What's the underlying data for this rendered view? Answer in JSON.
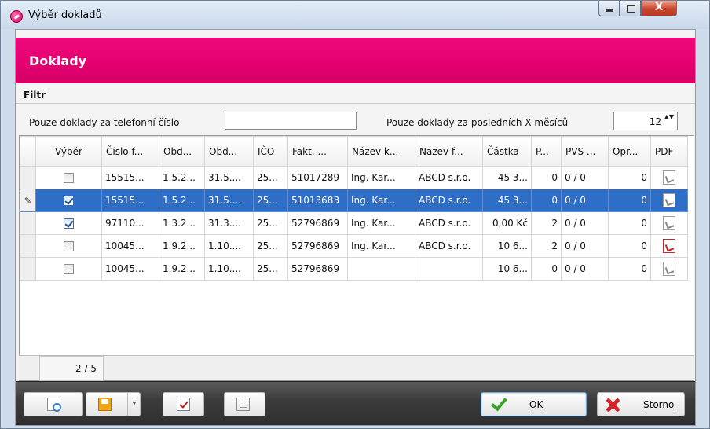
{
  "window": {
    "title": "Výběr dokladů",
    "close_glyph": "X"
  },
  "header": {
    "title": "Doklady"
  },
  "filter": {
    "section_label": "Filtr",
    "phone_label": "Pouze doklady za telefonní číslo",
    "phone_value": "",
    "months_label": "Pouze doklady za posledních X měsíců",
    "months_value": "12",
    "spin_arrows": "▲▼"
  },
  "grid": {
    "columns": [
      "Výběr",
      "Číslo f...",
      "Obd...",
      "Obd...",
      "IČO",
      "Fakt. ...",
      "Název k...",
      "Název f...",
      "Částka",
      "P...",
      "PVS ...",
      "Opr...",
      "PDF"
    ],
    "rows": [
      {
        "checked": false,
        "cislo": "15515...",
        "obd1": "1.5.2...",
        "obd2": "31.5....",
        "ico": "25...",
        "fakt": "51017289",
        "nazev_k": "Ing. Kar...",
        "nazev_f": "ABCD s.r.o.",
        "castka": "45 3...",
        "p": "0",
        "pvs": "0 / 0",
        "opr": "0",
        "pdf_icon": "pdf-icon",
        "selected": false
      },
      {
        "checked": true,
        "cislo": "15515...",
        "obd1": "1.5.2...",
        "obd2": "31.5....",
        "ico": "25...",
        "fakt": "51013683",
        "nazev_k": "Ing. Kar...",
        "nazev_f": "ABCD s.r.o.",
        "castka": "45 3...",
        "p": "0",
        "pvs": "0 / 0",
        "opr": "0",
        "pdf_icon": "pdf-icon",
        "selected": true,
        "indicator": "✎"
      },
      {
        "checked": true,
        "cislo": "97110...",
        "obd1": "1.3.2...",
        "obd2": "31.3....",
        "ico": "25...",
        "fakt": "52796869",
        "nazev_k": "Ing. Kar...",
        "nazev_f": "ABCD s.r.o.",
        "castka": "0,00 Kč",
        "p": "2",
        "pvs": "0 / 0",
        "opr": "0",
        "pdf_icon": "pdf-icon",
        "selected": false
      },
      {
        "checked": false,
        "cislo": "10045...",
        "obd1": "1.9.2...",
        "obd2": "1.10....",
        "ico": "25...",
        "fakt": "52796869",
        "nazev_k": "Ing. Kar...",
        "nazev_f": "ABCD s.r.o.",
        "castka": "10 6...",
        "p": "2",
        "pvs": "0 / 0",
        "opr": "0",
        "pdf_icon": "pdf-icon-red",
        "selected": false
      },
      {
        "checked": false,
        "cislo": "10045...",
        "obd1": "1.9.2...",
        "obd2": "1.10....",
        "ico": "25...",
        "fakt": "52796869",
        "nazev_k": "",
        "nazev_f": "",
        "castka": "10 6...",
        "p": "0",
        "pvs": "0 / 0",
        "opr": "0",
        "pdf_icon": "pdf-icon",
        "selected": false
      }
    ],
    "pager": "2 / 5"
  },
  "toolbar": {
    "ok_label": "OK",
    "cancel_label": "Storno",
    "dropdown_glyph": "▾"
  },
  "colors": {
    "accent_magenta": "#e3006f",
    "selection_blue": "#2f6ec7"
  }
}
